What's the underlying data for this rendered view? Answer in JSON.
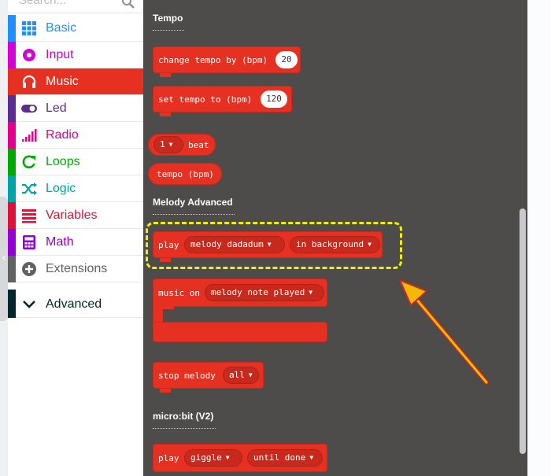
{
  "search": {
    "placeholder": "Search..."
  },
  "toolbox": {
    "categories": [
      {
        "label": "Basic",
        "color": "#1e90ff",
        "icon": "grid-icon"
      },
      {
        "label": "Input",
        "color": "#d400d4",
        "icon": "circle-dot-icon"
      },
      {
        "label": "Music",
        "color": "#e63022",
        "icon": "headphones-icon",
        "selected": true
      },
      {
        "label": "Led",
        "color": "#5c2d91",
        "icon": "toggle-icon"
      },
      {
        "label": "Radio",
        "color": "#e3008c",
        "icon": "signal-bars-icon"
      },
      {
        "label": "Loops",
        "color": "#00aa00",
        "icon": "loop-arrow-icon"
      },
      {
        "label": "Logic",
        "color": "#00a4a6",
        "icon": "shuffle-icon"
      },
      {
        "label": "Variables",
        "color": "#dc143c",
        "icon": "list-lines-icon"
      },
      {
        "label": "Math",
        "color": "#9400d3",
        "icon": "calculator-icon"
      },
      {
        "label": "Extensions",
        "color": "#616161",
        "icon": "plus-circle-icon"
      },
      {
        "label": "Advanced",
        "color": "#00272b",
        "icon": "chevron-down-icon"
      }
    ]
  },
  "workspace": {
    "sections": {
      "tempo": "Tempo",
      "melody_advanced": "Melody Advanced",
      "microbit_v2": "micro:bit (V2)"
    },
    "blocks": {
      "change_tempo": {
        "label": "change tempo by (bpm)",
        "value": "20"
      },
      "set_tempo": {
        "label": "set tempo to (bpm)",
        "value": "120"
      },
      "beat": {
        "dropdown": "1",
        "label": "beat"
      },
      "tempo_reporter": {
        "label": "tempo (bpm)"
      },
      "play_melody": {
        "label": "play",
        "melody": "melody dadadum",
        "mode": "in background"
      },
      "music_on": {
        "label": "music on",
        "event": "melody note played"
      },
      "stop_melody": {
        "label": "stop melody",
        "option": "all"
      },
      "play_sound": {
        "label": "play",
        "sound": "giggle",
        "mode": "until done"
      }
    }
  },
  "colors": {
    "music": "#e63022",
    "workspace_bg": "#4d4c4b",
    "highlight": "#f2f200",
    "arrow": "#f5b800"
  }
}
